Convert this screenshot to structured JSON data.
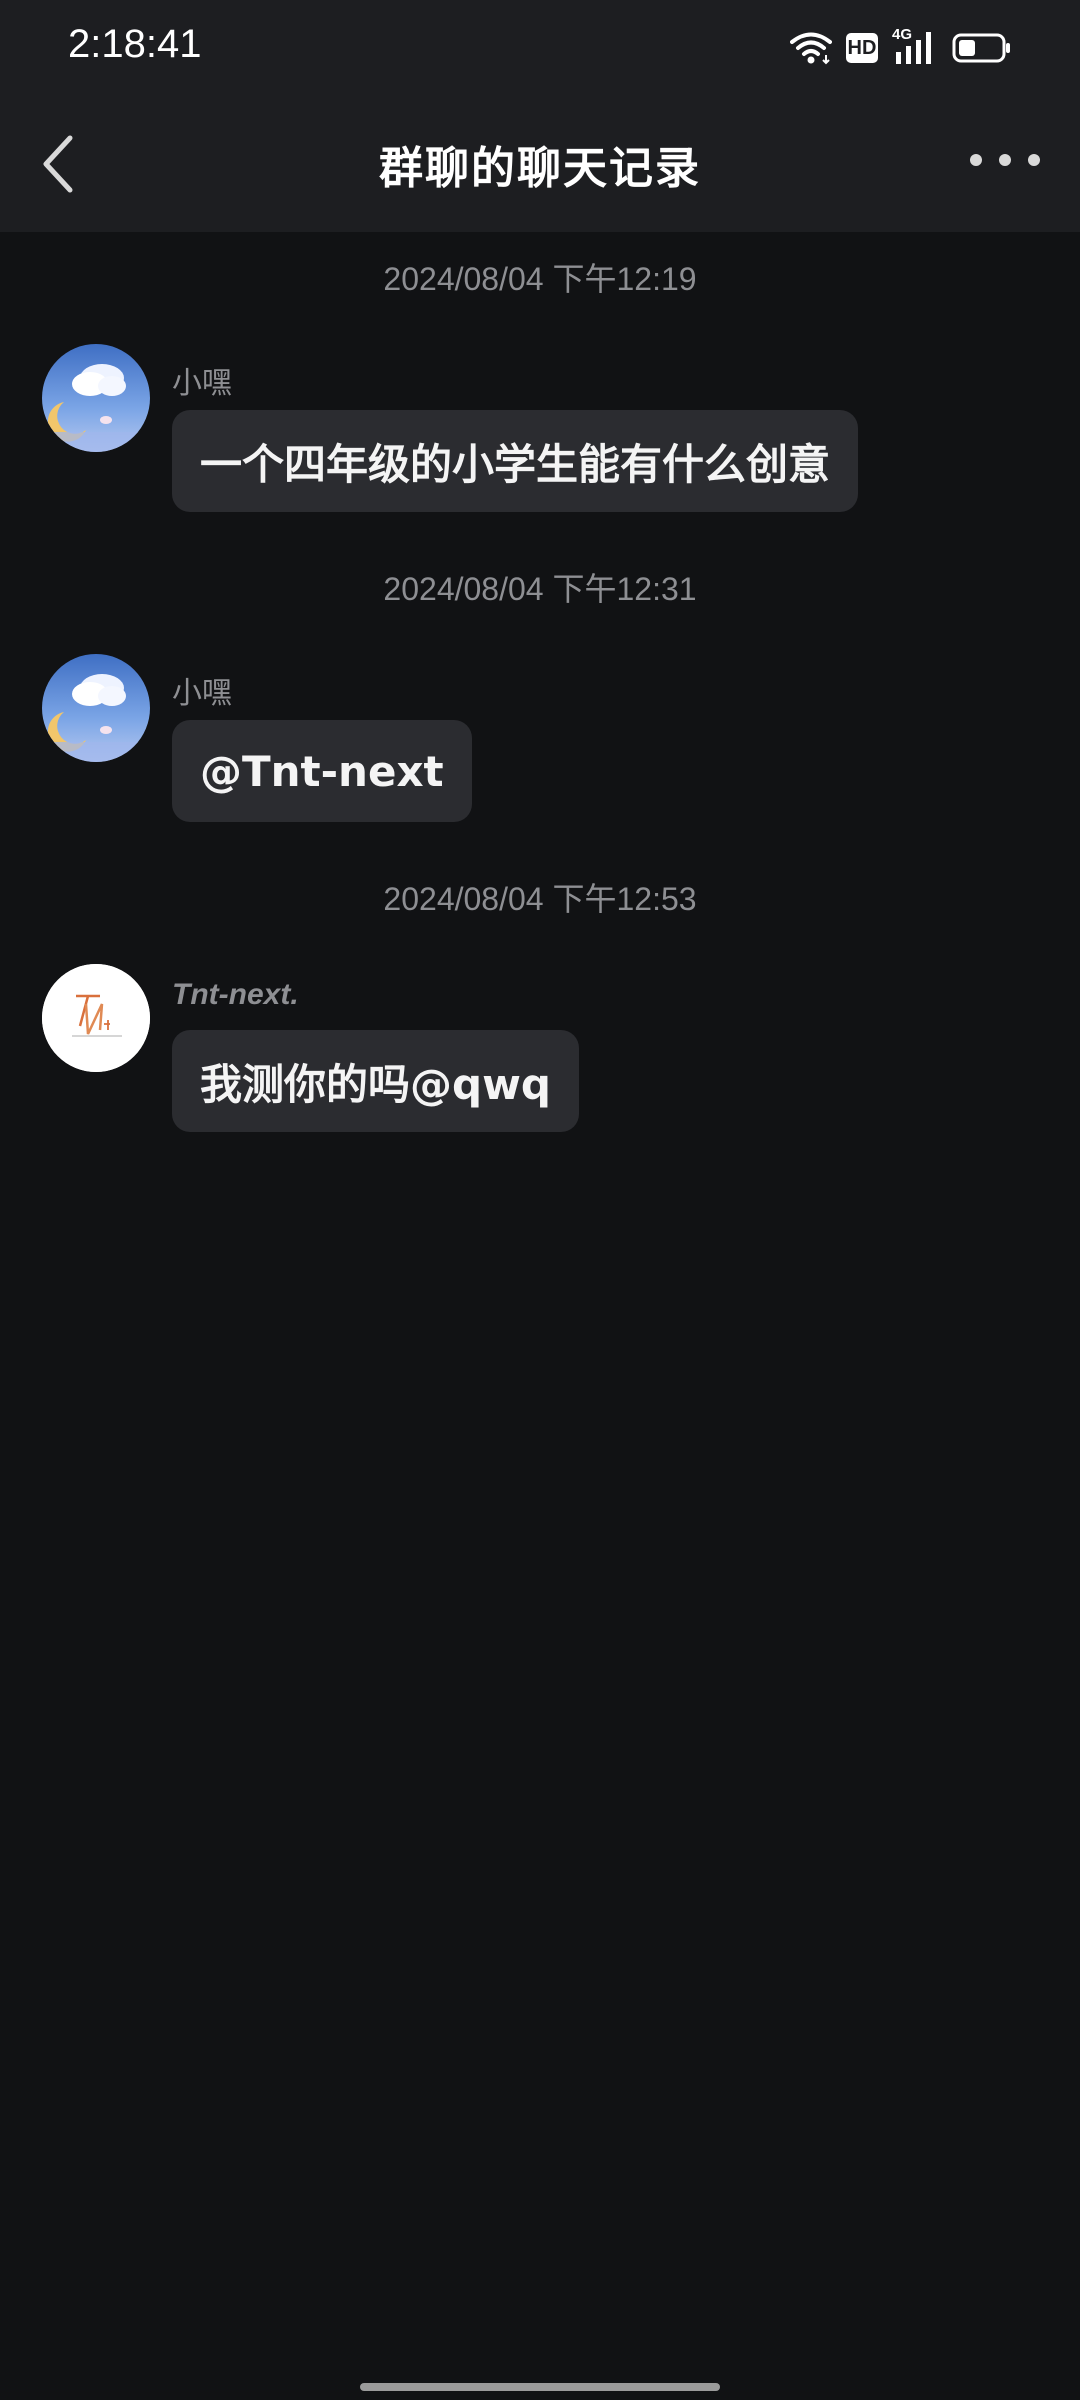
{
  "status_bar": {
    "time": "2:18:41",
    "hd_badge": "HD",
    "network_label": "4G",
    "battery_level": 0.4
  },
  "header": {
    "title": "群聊的聊天记录",
    "back_icon": "chevron-left-icon",
    "more_icon": "more-horizontal-icon"
  },
  "messages": [
    {
      "timestamp": "2024/08/04 下午12:19",
      "sender": "小嘿",
      "text": "一个四年级的小学生能有什么创意"
    },
    {
      "timestamp": "2024/08/04 下午12:31",
      "sender": "小嘿",
      "text": "@Tnt-next"
    },
    {
      "timestamp": "2024/08/04 下午12:53",
      "sender": "Tnt-next.",
      "text": "我测你的吗@qwq"
    }
  ],
  "colors": {
    "background": "#111214",
    "header_background": "#1d1e21",
    "bubble": "#2b2c30",
    "secondary_text": "#8e8f93"
  }
}
